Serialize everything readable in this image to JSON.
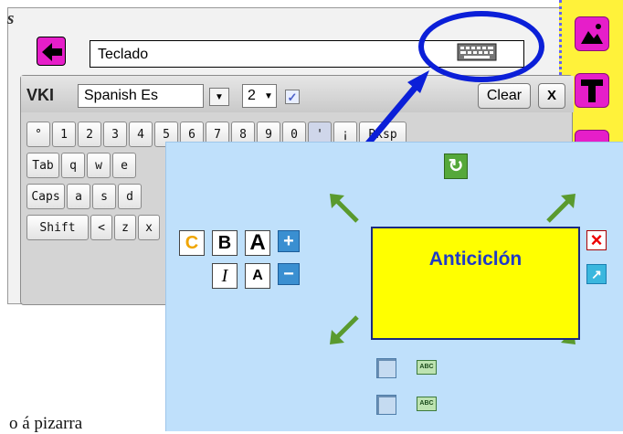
{
  "app": {
    "corner_text": "s",
    "text_field_value": "Teclado"
  },
  "vki": {
    "title": "VKI",
    "language": "Spanish Es",
    "size": "2",
    "checkbox_mark": "✓",
    "clear_label": "Clear",
    "close_label": "X",
    "rows": [
      [
        "°",
        "1",
        "2",
        "3",
        "4",
        "5",
        "6",
        "7",
        "8",
        "9",
        "0",
        "'",
        "¡",
        "Bksp"
      ],
      [
        "Tab",
        "q",
        "w",
        "e"
      ],
      [
        "Caps",
        "a",
        "s",
        "d"
      ],
      [
        "Shift",
        "<",
        "z",
        "x"
      ]
    ]
  },
  "edit_panel": {
    "rotate_glyph": "↻",
    "format_c": "C",
    "format_bold": "B",
    "format_a_large": "A",
    "format_italic": "I",
    "format_a_small": "A",
    "increase": "+",
    "decrease": "−",
    "text_box_label": "Anticiclón",
    "delete_glyph": "×",
    "share_glyph": "↗",
    "abc_label": "ABC"
  },
  "bottom_text": "o  á  pizarra",
  "colors": {
    "accent_magenta": "#e61ec9",
    "toolbar_yellow": "#fff23a",
    "annotation_blue": "#0b1fd8",
    "text_box_fill": "#ffff00",
    "panel_bg": "#bfe0fb"
  }
}
